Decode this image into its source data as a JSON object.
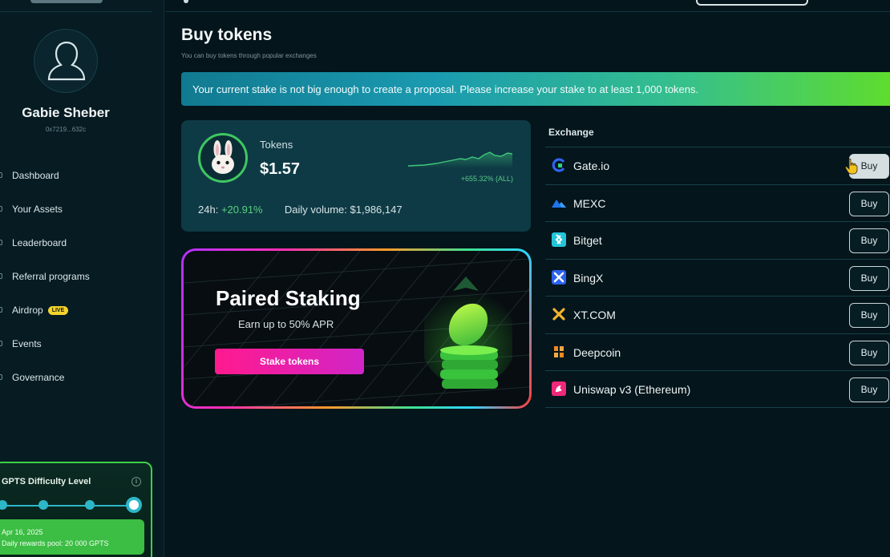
{
  "sidebar": {
    "user": {
      "name": "Gabie Sheber",
      "address": "0x7219...632c"
    },
    "nav": [
      {
        "label": "Dashboard"
      },
      {
        "label": "Your Assets"
      },
      {
        "label": "Leaderboard"
      },
      {
        "label": "Referral programs"
      },
      {
        "label": "Airdrop",
        "badge": "LIVE"
      },
      {
        "label": "Events"
      },
      {
        "label": "Governance"
      }
    ],
    "difficulty": {
      "title": "GPTS Difficulty Level",
      "level_steps": 4,
      "current_level": 4,
      "date": "Apr 16, 2025",
      "pool": "Daily rewards pool: 20 000 GPTS"
    }
  },
  "main": {
    "title": "Buy tokens",
    "subtitle": "You can buy tokens through popular exchanges",
    "banner": "Your current stake is not big enough to create a proposal. Please increase your stake to at least 1,000 tokens.",
    "token_card": {
      "label": "Tokens",
      "price": "$1.57",
      "change_all": "+655.32% (ALL)",
      "change_24h_label": "24h:",
      "change_24h": "+20.91%",
      "daily_volume": "Daily volume: $1,986,147"
    },
    "promo": {
      "title": "Paired Staking",
      "subtitle": "Earn up to 50% APR",
      "button": "Stake tokens"
    },
    "exchange_header": "Exchange",
    "exchanges": [
      {
        "name": "Gate.io",
        "icon": "gate-icon",
        "color": "#2354e6",
        "button": "Buy"
      },
      {
        "name": "MEXC",
        "icon": "mexc-icon",
        "color": "#1c6fe8",
        "button": "Buy"
      },
      {
        "name": "Bitget",
        "icon": "bitget-icon",
        "color": "#1dc4d8",
        "button": "Buy"
      },
      {
        "name": "BingX",
        "icon": "bingx-icon",
        "color": "#2b63f0",
        "button": "Buy"
      },
      {
        "name": "XT.COM",
        "icon": "xt-icon",
        "color": "#f2b32b",
        "button": "Buy"
      },
      {
        "name": "Deepcoin",
        "icon": "deepcoin-icon",
        "color": "#f08a22",
        "button": "Buy"
      },
      {
        "name": "Uniswap v3 (Ethereum)",
        "icon": "uniswap-icon",
        "color": "#f0287b",
        "button": "Buy"
      }
    ]
  },
  "colors": {
    "background": "#04151b",
    "accent_green": "#3ecf49",
    "accent_teal": "#2db6c8",
    "positive": "#58d17f",
    "promo_button": "#ff1a8e"
  }
}
